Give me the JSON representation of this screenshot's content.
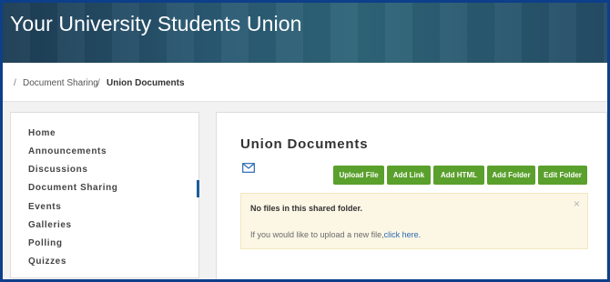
{
  "header": {
    "title": "Your University Students Union"
  },
  "breadcrumb": {
    "separator": "/",
    "items": [
      "Document Sharing",
      "Union Documents"
    ]
  },
  "sidebar": {
    "items": [
      {
        "label": "Home"
      },
      {
        "label": "Announcements"
      },
      {
        "label": "Discussions"
      },
      {
        "label": "Document Sharing",
        "active": true
      },
      {
        "label": "Events"
      },
      {
        "label": "Galleries"
      },
      {
        "label": "Polling"
      },
      {
        "label": "Quizzes"
      }
    ]
  },
  "main": {
    "title": "Union Documents",
    "mail_icon": "envelope-icon",
    "buttons": [
      "Upload File",
      "Add Link",
      "Add HTML",
      "Add Folder",
      "Edit Folder"
    ],
    "alert": {
      "heading": "No files in this shared folder.",
      "text": "If you would like to upload a new file,",
      "link": "click here.",
      "close": "×"
    }
  },
  "colors": {
    "banner": "#244d66",
    "button": "#5aa02c",
    "active_indicator": "#1c5d99",
    "alert_bg": "#fcf6e5",
    "frame_border": "#0d3f8a"
  }
}
